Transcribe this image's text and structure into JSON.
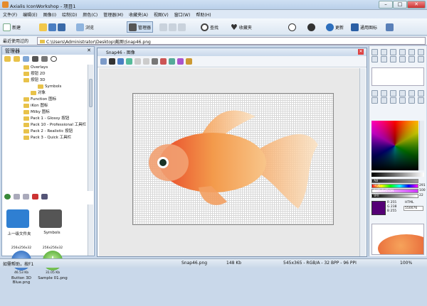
{
  "window": {
    "title": "Axialis IconWorkshop - 项目1",
    "minimize": "–",
    "maximize": "□",
    "close": "✕"
  },
  "menu": [
    "文件(F)",
    "编辑(E)",
    "图像(I)",
    "绘制(D)",
    "颜色(C)",
    "管理器(M)",
    "收藏夹(A)",
    "视图(V)",
    "窗口(W)",
    "帮助(H)"
  ],
  "toolbar": {
    "new": "新建",
    "browse": "浏览",
    "manager": "管理器",
    "search": "查找",
    "favorites": "收藏夹",
    "update": "更新",
    "general_icons": "通用图标"
  },
  "pathbar": {
    "label": "最近使用过的",
    "path": "C:\\Users\\Administrator\\Desktop\\截图\\Snap46.png"
  },
  "manager": {
    "title": "管理器",
    "tree": [
      "Overlays",
      "按钮 2D",
      "按钮 3D",
      "Symbols",
      "对象",
      "Function 图标",
      "iKon 图标",
      "Milky 图标",
      "Pack 1 - Glossy 按钮",
      "Pack 10 - Professional 工具栏",
      "Pack 2 - Realistic 按钮",
      "Pack 3 - Quick 工具栏"
    ],
    "files": [
      {
        "name": "上一级文件夹",
        "badge": ""
      },
      {
        "name": "Symbols",
        "badge": ""
      },
      {
        "name": "Button 3D Blue.png",
        "badge": "256x256x32",
        "size": "46.53 Kb"
      },
      {
        "name": "Sample 01.png",
        "badge": "256x256x32",
        "size": "31.05 Kb"
      }
    ]
  },
  "document": {
    "tab_title": "Snap46 - 图像"
  },
  "right": {
    "hue_label": "HUE",
    "hue_val": "291",
    "sat_label": "SATURATION",
    "sat_val": "100",
    "bri_label": "BRI",
    "bri_val": "22",
    "rgb": {
      "r": "255",
      "g": "238",
      "b": "255"
    },
    "html_label": "HTML",
    "html_val": "550076",
    "ab_label": "AB",
    "ab_val": "255"
  },
  "status": {
    "help": "如需帮助，按F1",
    "file": "Snap46.png",
    "size": "148 Kb",
    "info": "545x365 - RGB/A - 32 BPP - 96 PPI",
    "zoom": "100%"
  },
  "colors": {
    "accent": "#3b78c4"
  }
}
